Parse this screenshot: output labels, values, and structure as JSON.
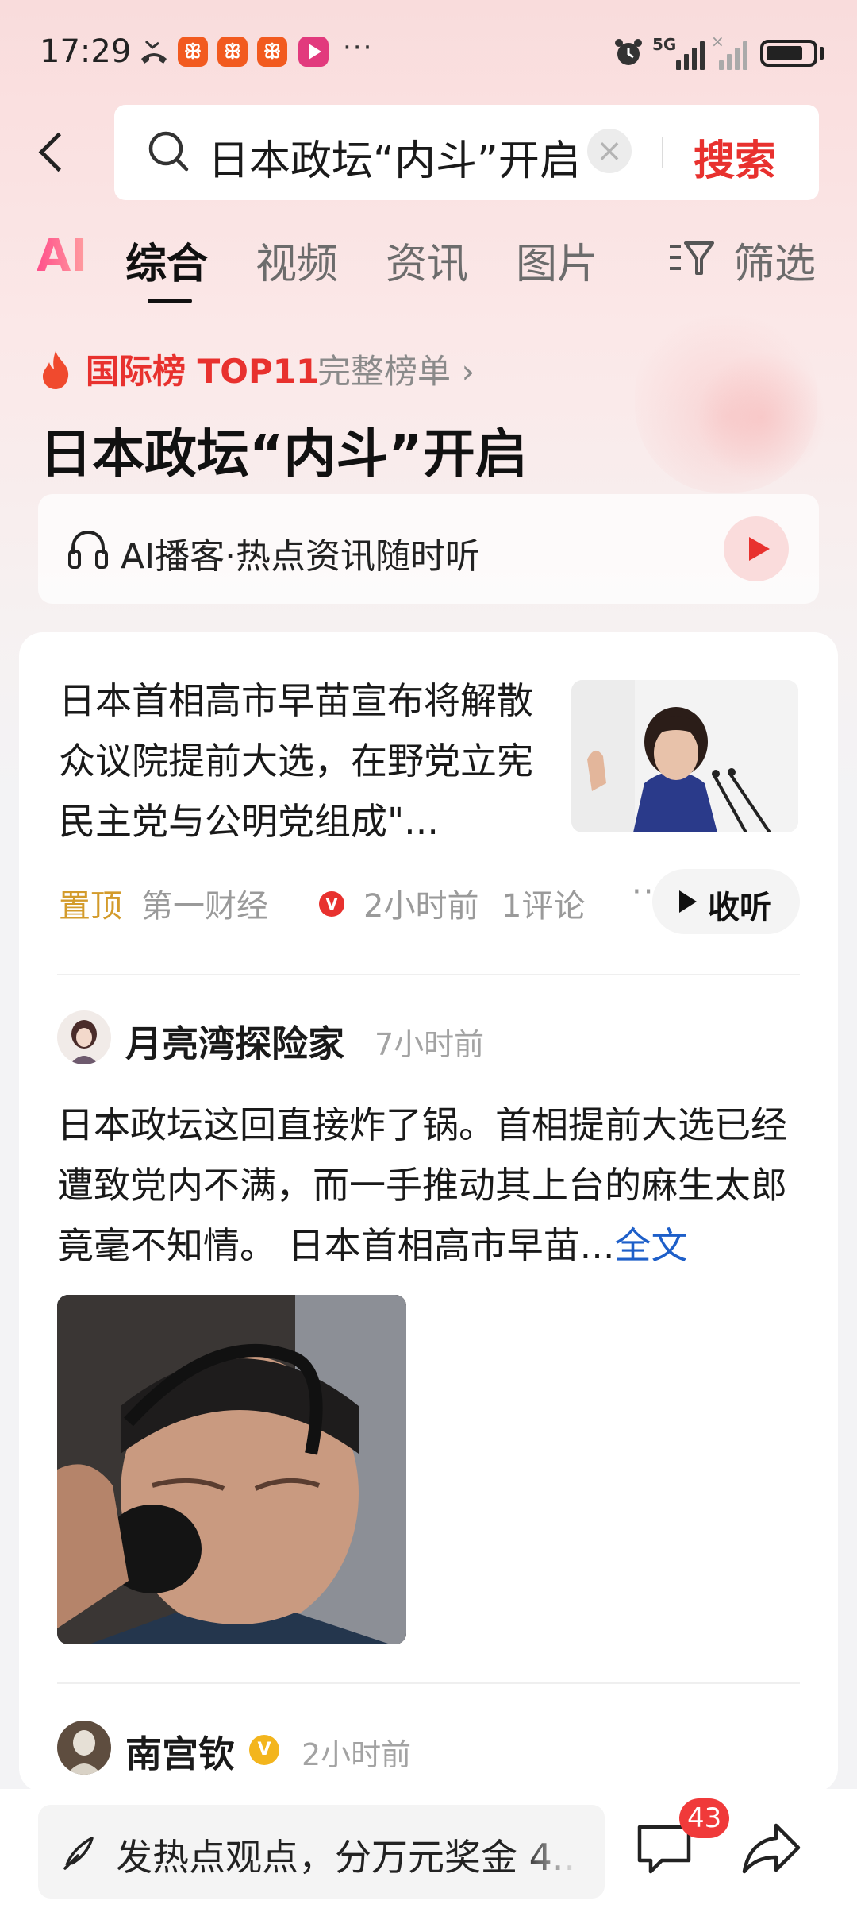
{
  "status_bar": {
    "time": "17:29",
    "network": "5G",
    "battery_level": 0.8,
    "icons": [
      "missed-call-icon",
      "app-icon",
      "app-icon",
      "app-icon",
      "video-app-icon",
      "alarm-icon",
      "signal-icon",
      "battery-icon"
    ],
    "overflow": "···"
  },
  "header": {
    "search_query": "日本政坛“内斗”开启",
    "search_button": "搜索",
    "clear_icon": "×"
  },
  "tabs": {
    "items": [
      {
        "label": "AI"
      },
      {
        "label": "综合",
        "active": true
      },
      {
        "label": "视频"
      },
      {
        "label": "资讯"
      },
      {
        "label": "图片"
      }
    ],
    "filter_label": "筛选"
  },
  "topic": {
    "rank_label": "国际榜 TOP11",
    "rank_more": "完整榜单 ›",
    "title": "日本政坛“内斗”开启",
    "podcast_label": "AI播客·热点资讯随时听"
  },
  "news": {
    "title": "日本首相高市早苗宣布将解散众议院提前大选，在野党立宪民主党与公明党组成\"...",
    "pin": "置顶",
    "source": "第一财经",
    "source_badge": "V",
    "time": "2小时前",
    "comments": "1评论",
    "more": "···",
    "listen_label": "收听"
  },
  "posts": [
    {
      "author": "月亮湾探险家",
      "time": "7小时前",
      "text": "日本政坛这回直接炸了锅。首相提前大选已经遭致党内不满，而一手推动其上台的麻生太郎竟毫不知情。 日本首相高市早苗...",
      "fulltext_label": "全文"
    },
    {
      "author": "南宫钦",
      "badge": "V",
      "time": "2小时前"
    }
  ],
  "bottom_bar": {
    "comment_placeholder": "发热点观点，分万元奖金 4..",
    "comment_count": "43"
  },
  "colors": {
    "accent_red": "#e8312e",
    "link_blue": "#1e5fc9",
    "pin_gold": "#d39b2b"
  }
}
